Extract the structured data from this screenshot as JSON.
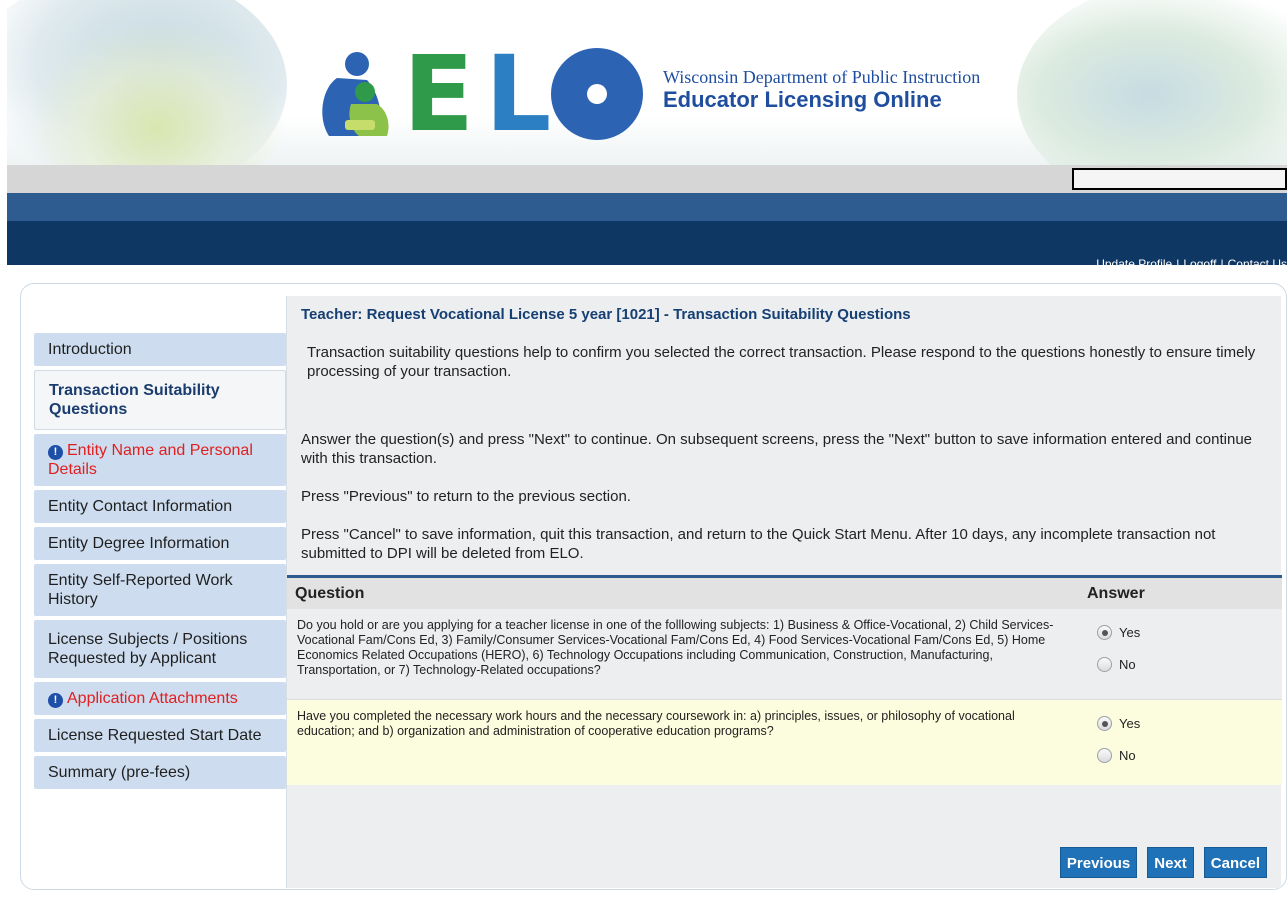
{
  "header": {
    "agency_line": "Wisconsin Department of Public Instruction",
    "app_name": "Educator Licensing Online",
    "logo_text": "ELO"
  },
  "util_links": {
    "update_profile": "Update Profile",
    "logoff": "Logoff",
    "contact_us": "Contact Us",
    "separator": "|"
  },
  "sidebar": {
    "items": [
      {
        "label": "Introduction",
        "state": "normal"
      },
      {
        "label": "Transaction Suitability Questions",
        "state": "active"
      },
      {
        "label": "Entity Name and Personal Details",
        "state": "alert"
      },
      {
        "label": "Entity Contact Information",
        "state": "normal"
      },
      {
        "label": "Entity Degree Information",
        "state": "normal"
      },
      {
        "label": "Entity Self-Reported Work History",
        "state": "normal"
      },
      {
        "label": "License Subjects / Positions Requested by Applicant",
        "state": "normal"
      },
      {
        "label": "Application Attachments",
        "state": "alert"
      },
      {
        "label": "License Requested Start Date",
        "state": "normal"
      },
      {
        "label": "Summary (pre-fees)",
        "state": "normal"
      }
    ]
  },
  "main": {
    "title": "Teacher: Request Vocational License 5 year [1021] - Transaction Suitability Questions",
    "intro": "Transaction suitability questions help to confirm you selected the correct transaction. Please respond to the questions honestly to ensure timely processing of your transaction.",
    "instr_next": "Answer the question(s) and press \"Next\" to continue. On subsequent screens, press the \"Next\" button to save information entered and continue with this transaction.",
    "instr_previous": "Press \"Previous\" to return to the previous section.",
    "instr_cancel": "Press \"Cancel\" to save information, quit this transaction, and return to the Quick Start Menu. After 10 days, any incomplete transaction not submitted to DPI will be deleted from ELO."
  },
  "questions": {
    "header_question": "Question",
    "header_answer": "Answer",
    "rows": [
      {
        "text": "Do you hold or are you applying for a teacher license in one of the folllowing subjects: 1) Business & Office-Vocational, 2) Child Services-Vocational Fam/Cons Ed, 3) Family/Consumer Services-Vocational Fam/Cons Ed, 4) Food Services-Vocational Fam/Cons Ed, 5) Home Economics Related Occupations (HERO), 6) Technology Occupations including Communication, Construction, Manufacturing, Transportation, or 7) Technology-Related occupations?",
        "yes": "Yes",
        "no": "No",
        "selected": "Yes"
      },
      {
        "text": "Have you completed the necessary work hours and the necessary coursework in: a) principles, issues, or philosophy of vocational education; and b) organization and administration of cooperative education programs?",
        "yes": "Yes",
        "no": "No",
        "selected": "Yes"
      }
    ]
  },
  "buttons": {
    "previous": "Previous",
    "next": "Next",
    "cancel": "Cancel"
  },
  "colors": {
    "navy": "#0f3763",
    "blue_bar": "#2e5b90",
    "nav_bg": "#cdddef",
    "alert_red": "#e01f1f",
    "button_blue": "#1f72b8",
    "row_highlight": "#fcfcde"
  }
}
